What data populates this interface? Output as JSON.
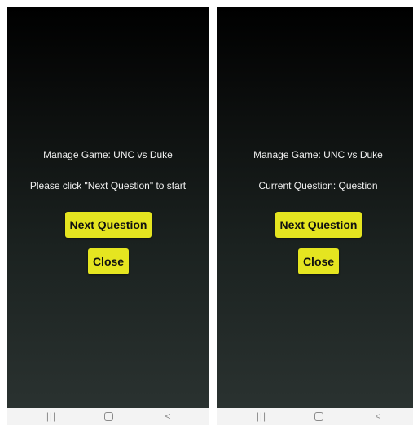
{
  "screens": [
    {
      "title": "Manage Game: UNC vs Duke",
      "subtitle": "Please click \"Next Question\" to start",
      "next_label": "Next Question",
      "close_label": "Close"
    },
    {
      "title": "Manage Game: UNC vs Duke",
      "subtitle": "Current Question: Question",
      "next_label": "Next Question",
      "close_label": "Close"
    }
  ],
  "navbar": {
    "recents_icon": "recents-icon",
    "home_icon": "home-icon",
    "back_icon": "back-icon",
    "recents_glyph": "|||",
    "back_glyph": "<"
  },
  "colors": {
    "button_bg": "#e5e520",
    "screen_top": "#000000",
    "screen_bottom": "#2a3230",
    "navbar_bg": "#f3f3f3"
  }
}
